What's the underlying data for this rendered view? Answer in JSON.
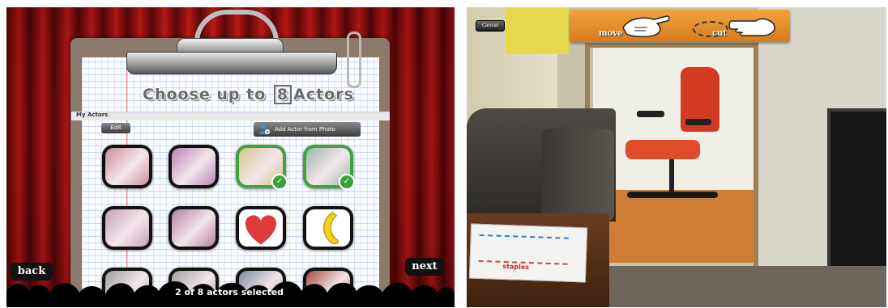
{
  "left_screen": {
    "title_prefix": "Choose up to",
    "title_number": "8",
    "title_suffix": "Actors",
    "section_label": "My Actors",
    "edit_label": "Edit",
    "add_actor_label": "Add Actor from Photo",
    "tiles": [
      {
        "name": "dollhouse-pink-1",
        "selected": false,
        "color": "#c98f9c"
      },
      {
        "name": "dollhouse-purple-1",
        "selected": false,
        "color": "#b784b5"
      },
      {
        "name": "dollhouse-room-green",
        "selected": true,
        "color": "#d7c28a"
      },
      {
        "name": "dollhouse-teal",
        "selected": true,
        "color": "#9db8a5"
      },
      {
        "name": "dollhouse-pink-2",
        "selected": false,
        "color": "#c7a0b9"
      },
      {
        "name": "dollhouse-pink-3",
        "selected": false,
        "color": "#b07fa0"
      },
      {
        "name": "red-heart",
        "selected": false,
        "color": "#e03b3b"
      },
      {
        "name": "yellow-banana",
        "selected": false,
        "color": "#f3cf1f"
      },
      {
        "name": "row3-tile-1",
        "selected": false,
        "color": "#9e9e9e"
      },
      {
        "name": "row3-tile-2",
        "selected": false,
        "color": "#9e9e9e"
      },
      {
        "name": "row3-tile-3",
        "selected": false,
        "color": "#7b8b9b"
      },
      {
        "name": "row3-tile-4",
        "selected": false,
        "color": "#a34a3e"
      }
    ],
    "back_label": "back",
    "next_label": "next",
    "status_text": "2 of 8 actors selected"
  },
  "right_screen": {
    "cancel_label": "Cancel",
    "move_label": "move",
    "cut_label": "cut",
    "paper_text": "staples"
  }
}
